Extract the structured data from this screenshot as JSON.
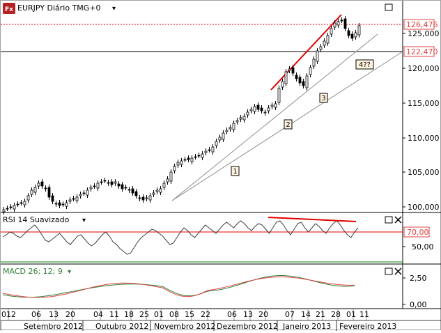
{
  "header": {
    "app_icon": "fx-icon",
    "app_icon_text": "Fx",
    "symbol_title": "EURJPY Diário TMG+0",
    "dropdown_arrow": "▾"
  },
  "price_panel": {
    "y_ticks": [
      "125,000",
      "120,000",
      "115,000",
      "110,000",
      "105,000",
      "100,000"
    ],
    "current_price": "126,476",
    "horizontal_line_price": "122,470",
    "label_4": "4??",
    "wave_labels": [
      "1",
      "2",
      "3"
    ],
    "colors": {
      "bull": "#ffffff",
      "bear": "#000000",
      "trend_red": "#e00000",
      "trend_gray": "#808080",
      "price_tag": "#e04040"
    }
  },
  "rsi_panel": {
    "title": "RSI 14 Suavizado",
    "level_label": "70,00",
    "tick_50": "50,00",
    "colors": {
      "line": "#404040",
      "upper": "#e00000",
      "lower": "#008000"
    }
  },
  "macd_panel": {
    "title": "MACD 26; 12; 9",
    "ticks": [
      "2,50",
      "0,00"
    ],
    "colors": {
      "macd": "#e04040",
      "signal": "#2e7d32",
      "title": "#2e7d32"
    }
  },
  "x_axis": {
    "day_labels": [
      "012",
      "06",
      "13",
      "20",
      "04",
      "11",
      "18",
      "25",
      "01",
      "08",
      "15",
      "22",
      "06",
      "13",
      "20",
      "07",
      "14",
      "21",
      "28",
      "01",
      "11"
    ],
    "month_labels": [
      "Setembro 2012",
      "Outubro 2012",
      "Novembro 2012",
      "Dezembro 2012",
      "Janeiro 2013",
      "Fevereiro 2013"
    ]
  },
  "icons": {
    "maximize": "maximize-icon",
    "close": "close-icon"
  }
}
